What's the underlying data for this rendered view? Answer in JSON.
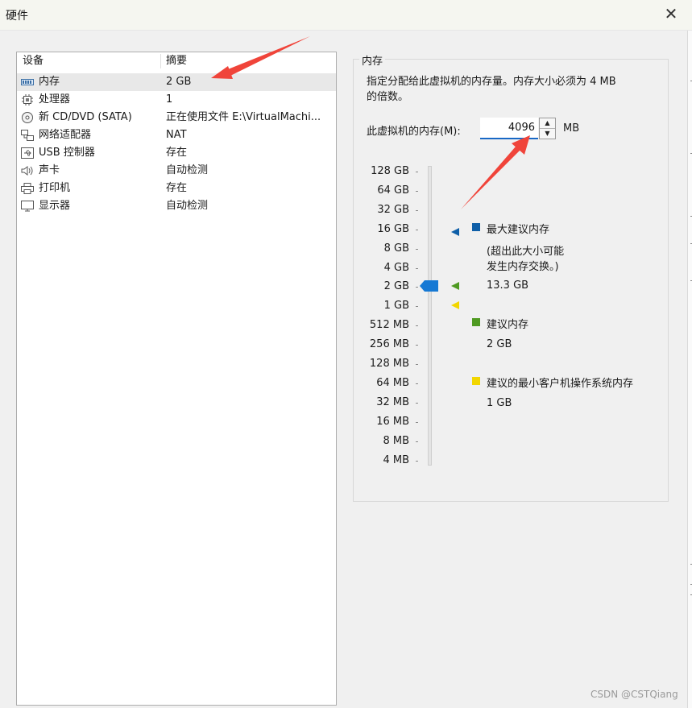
{
  "window": {
    "title": "硬件"
  },
  "devices": {
    "col_device": "设备",
    "col_summary": "摘要",
    "items": [
      {
        "name": "内存",
        "summary": "2 GB",
        "icon": "memory-icon",
        "selected": true
      },
      {
        "name": "处理器",
        "summary": "1",
        "icon": "processor-icon"
      },
      {
        "name": "新 CD/DVD (SATA)",
        "summary": "正在使用文件 E:\\VirtualMachi...",
        "icon": "cd-dvd-icon"
      },
      {
        "name": "网络适配器",
        "summary": "NAT",
        "icon": "network-adapter-icon"
      },
      {
        "name": "USB 控制器",
        "summary": "存在",
        "icon": "usb-icon"
      },
      {
        "name": "声卡",
        "summary": "自动检测",
        "icon": "sound-card-icon"
      },
      {
        "name": "打印机",
        "summary": "存在",
        "icon": "printer-icon"
      },
      {
        "name": "显示器",
        "summary": "自动检测",
        "icon": "display-icon"
      }
    ]
  },
  "memory": {
    "group_title": "内存",
    "desc_line1": "指定分配给此虚拟机的内存量。内存大小必须为 4 MB",
    "desc_line2": "的倍数。",
    "field_label": "此虚拟机的内存(M):",
    "value": "4096",
    "unit": "MB",
    "scale_labels": [
      "128 GB",
      "64 GB",
      "32 GB",
      "16 GB",
      "8 GB",
      "4 GB",
      "2 GB",
      "1 GB",
      "512 MB",
      "256 MB",
      "128 MB",
      "64 MB",
      "32 MB",
      "16 MB",
      "8 MB",
      "4 MB"
    ],
    "slider_value": "2 GB",
    "legend": {
      "max_title": "最大建议内存",
      "max_note1": "(超出此大小可能",
      "max_note2": "发生内存交换。)",
      "max_value": "13.3 GB",
      "rec_title": "建议内存",
      "rec_value": "2 GB",
      "min_title": "建议的最小客户机操作系统内存",
      "min_value": "1 GB"
    },
    "colors": {
      "max": "#0f5fa8",
      "rec": "#4f9a22",
      "min": "#f2d600",
      "thumb": "#1679d4",
      "arrow": "#f0443a"
    }
  },
  "watermark": "CSDN @CSTQiang"
}
